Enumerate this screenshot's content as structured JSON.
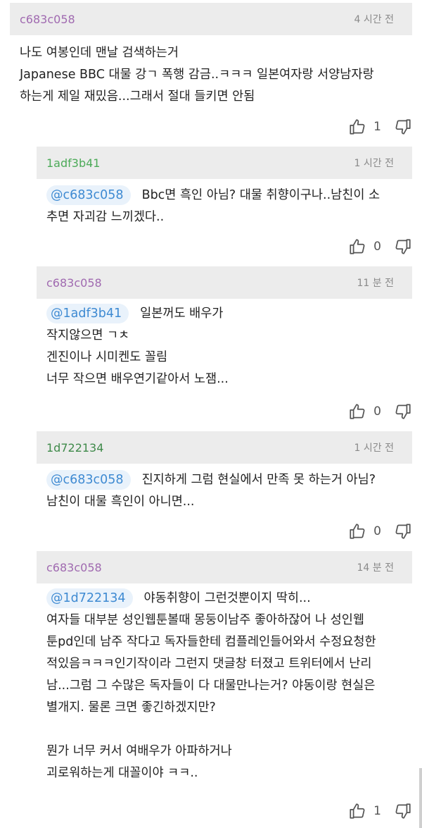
{
  "comments": [
    {
      "author": "c683c058",
      "author_color": "#a06ab0",
      "time": "4 시간 전",
      "mention": "",
      "lines": [
        "나도 여봉인데 맨날 검색하는거",
        "Japanese BBC 대물 강ㄱ 폭행 감금..ㅋㅋㅋ 일본여자랑 서양남자랑",
        "하는게 제일 재밌음...그래서 절대 들키면 안됨"
      ],
      "likes": "1"
    },
    {
      "author": "1adf3b41",
      "author_color": "#4caa58",
      "time": "1 시간 전",
      "mention": "@c683c058",
      "lines": [
        "Bbc면 흑인 아님? 대물 취향이구나..남친이 소",
        "추면 자괴감 느끼겠다.."
      ],
      "likes": "0"
    },
    {
      "author": "c683c058",
      "author_color": "#a06ab0",
      "time": "11 분 전",
      "mention": "@1adf3b41",
      "lines": [
        "일본꺼도 배우가",
        "작지않으면 ㄱㅊ",
        "겐진이나 시미켄도 꼴림",
        "너무 작으면 배우연기같아서 노잼..."
      ],
      "likes": "0"
    },
    {
      "author": "1d722134",
      "author_color": "#3f8a4a",
      "time": "1 시간 전",
      "mention": "@c683c058",
      "lines": [
        "진지하게 그럼 현실에서 만족 못 하는거 아님?",
        "남친이 대물 흑인이 아니면..."
      ],
      "likes": "0"
    },
    {
      "author": "c683c058",
      "author_color": "#a06ab0",
      "time": "14 분 전",
      "mention": "@1d722134",
      "lines": [
        "야동취향이 그런것뿐이지 딱히...",
        "여자들 대부분 성인웹툰볼때 몽둥이남주 좋아하잖어 나 성인웹",
        "툰pd인데 남주 작다고 독자들한테 컴플레인들어와서 수정요청한",
        "적있음ㅋㅋㅋ인기작이라 그런지 댓글창 터졌고 트위터에서 난리",
        "남...그럼 그 수많은 독자들이 다 대물만나는거? 야동이랑 현실은",
        "별개지. 물론 크면 좋긴하겠지만?",
        "",
        "뭔가 너무 커서 여배우가 아파하거나",
        "괴로워하는게 대꼴이야 ㅋㅋ.."
      ],
      "likes": "1"
    }
  ]
}
